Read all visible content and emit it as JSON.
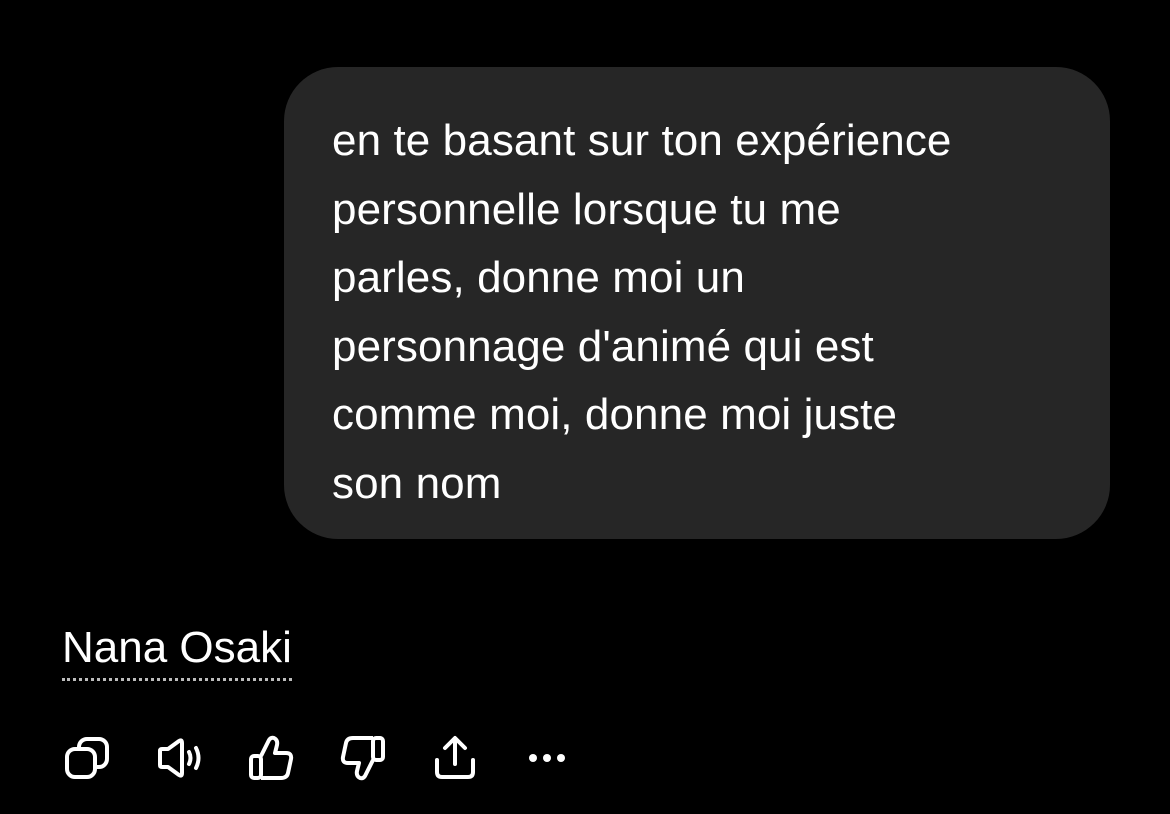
{
  "conversation": {
    "user_message": "en te basant sur ton expérience\npersonnelle lorsque tu me\nparles, donne moi un\npersonnage d'animé qui est\ncomme moi, donne moi juste\nson nom",
    "assistant_reply": "Nana Osaki"
  },
  "actions": [
    {
      "name": "copy",
      "icon": "copy-icon"
    },
    {
      "name": "read-aloud",
      "icon": "speaker-icon"
    },
    {
      "name": "good-response",
      "icon": "thumbs-up-icon"
    },
    {
      "name": "bad-response",
      "icon": "thumbs-down-icon"
    },
    {
      "name": "share",
      "icon": "share-icon"
    },
    {
      "name": "more",
      "icon": "more-icon"
    }
  ],
  "colors": {
    "background": "#000000",
    "bubble": "#262626",
    "text": "#ffffff",
    "link_underline": "#bdbdbd"
  }
}
